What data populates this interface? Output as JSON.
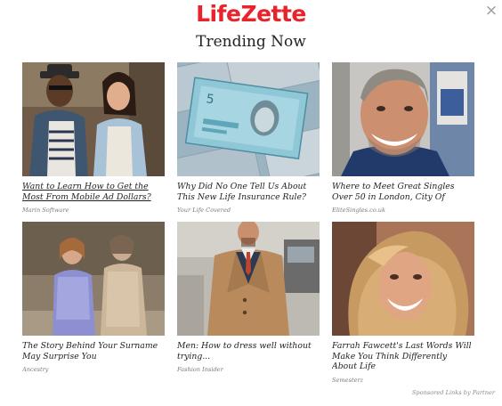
{
  "header": {
    "logo_text": "LifeZette",
    "heading": "Trending Now",
    "close_glyph": "×"
  },
  "cards": [
    {
      "title": "Want to Learn How to Get the Most From Mobile Ad Dollars?",
      "source": "Marin Software",
      "image": "couple-laughing-photo"
    },
    {
      "title": "Why Did No One Tell Us About This New Life Insurance Rule?",
      "source": "Your Life Covered",
      "image": "banknotes-photo"
    },
    {
      "title": "Where to Meet Great Singles Over 50 in London, City Of",
      "source": "EliteSingles.co.uk",
      "image": "smiling-man-photo"
    },
    {
      "title": "The Story Behind Your Surname May Surprise You",
      "source": "Ancestry",
      "image": "vintage-girls-photo"
    },
    {
      "title": "Men: How to dress well without trying...",
      "source": "Fashion Insider",
      "image": "man-in-coat-photo"
    },
    {
      "title": "Farrah Fawcett's Last Words Will Make You Think Differently About Life",
      "source": "Semesterz",
      "image": "blonde-woman-photo"
    }
  ],
  "footer": {
    "sponsored": "Sponsored Links by Partner"
  },
  "colors": {
    "brand": "#e8232b",
    "title_text": "#222222",
    "source_text": "#7a7a7a"
  }
}
